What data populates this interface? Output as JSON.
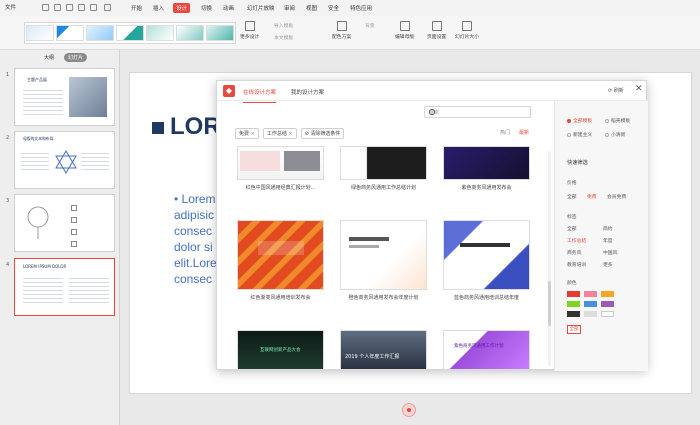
{
  "menubar": {
    "file": "文件",
    "tabs": [
      "开始",
      "插入",
      "设计",
      "切换",
      "动画",
      "幻灯片放映",
      "审阅",
      "视图",
      "安全",
      "特色应用"
    ],
    "active_tab": "设计"
  },
  "ribbon": {
    "more_designs": "更多设计",
    "import_template": "导入模板",
    "this_template": "本文模板",
    "color_scheme": "配色方案",
    "background": "背景",
    "edit_master": "编辑母版",
    "page_setup": "页面设置",
    "slide_size": "幻灯片大小"
  },
  "sidebar": {
    "tab_outline": "大纲",
    "tab_slides": "幻灯片",
    "slide_numbers": [
      "1",
      "2",
      "3",
      "4"
    ],
    "slide1_title": "主题产品展",
    "slide2_title": "母版的文本和布局",
    "slide4_title": "LOREM IPSUM DOLOR"
  },
  "canvas": {
    "title": "LORE",
    "body_lines": [
      "• Lorem",
      "adipisic",
      "consec",
      "dolor si",
      "elit.Lore",
      "consec"
    ]
  },
  "dialog": {
    "tab_online": "在线设计方案",
    "tab_mine": "我的设计方案",
    "refresh": "刷新",
    "search_placeholder": "搜索",
    "filter_free": "免费",
    "filter_work": "工作总结",
    "filter_clear": "清除筛选条件",
    "sort_hot": "热门",
    "sort_new": "最新",
    "templates": [
      {
        "caption": "红色中国风通用经典汇报计划..."
      },
      {
        "caption": "绿色商务风通用工作总结计划"
      },
      {
        "caption": "紫色商务风通用发布会"
      },
      {
        "caption": "红色渐变风通用培训发布会"
      },
      {
        "caption": "橙色商务风通用发布会年度计划"
      },
      {
        "caption": "蓝色商务风通用培训总结年度"
      },
      {
        "caption": "互联网创新产品大会"
      },
      {
        "caption": "2019 个人年度工作汇报"
      },
      {
        "caption": "紫色商务风通用工作计划"
      }
    ],
    "right_panel": {
      "scope_all": "全部模板",
      "scope_member": "稻壳模板",
      "scope_custom": "新建主义",
      "scope_recent": "小清新",
      "quick_filter": "快速筛选",
      "price_label": "价格",
      "price_all": "全部",
      "price_free": "免费",
      "price_member": "会员免费",
      "tag_label": "标签",
      "tags": [
        "全部",
        "简约",
        "工作总结",
        "年度",
        "商务风",
        "中国风",
        "教育培训",
        "更多"
      ],
      "color_label": "颜色",
      "colors": [
        "#e53b33",
        "#f1829a",
        "#f5a623",
        "#7ed321",
        "#4a90e2",
        "#9b59b6",
        "#333333",
        "#dddddd",
        "#ffffff"
      ],
      "color_all": "全部"
    }
  }
}
